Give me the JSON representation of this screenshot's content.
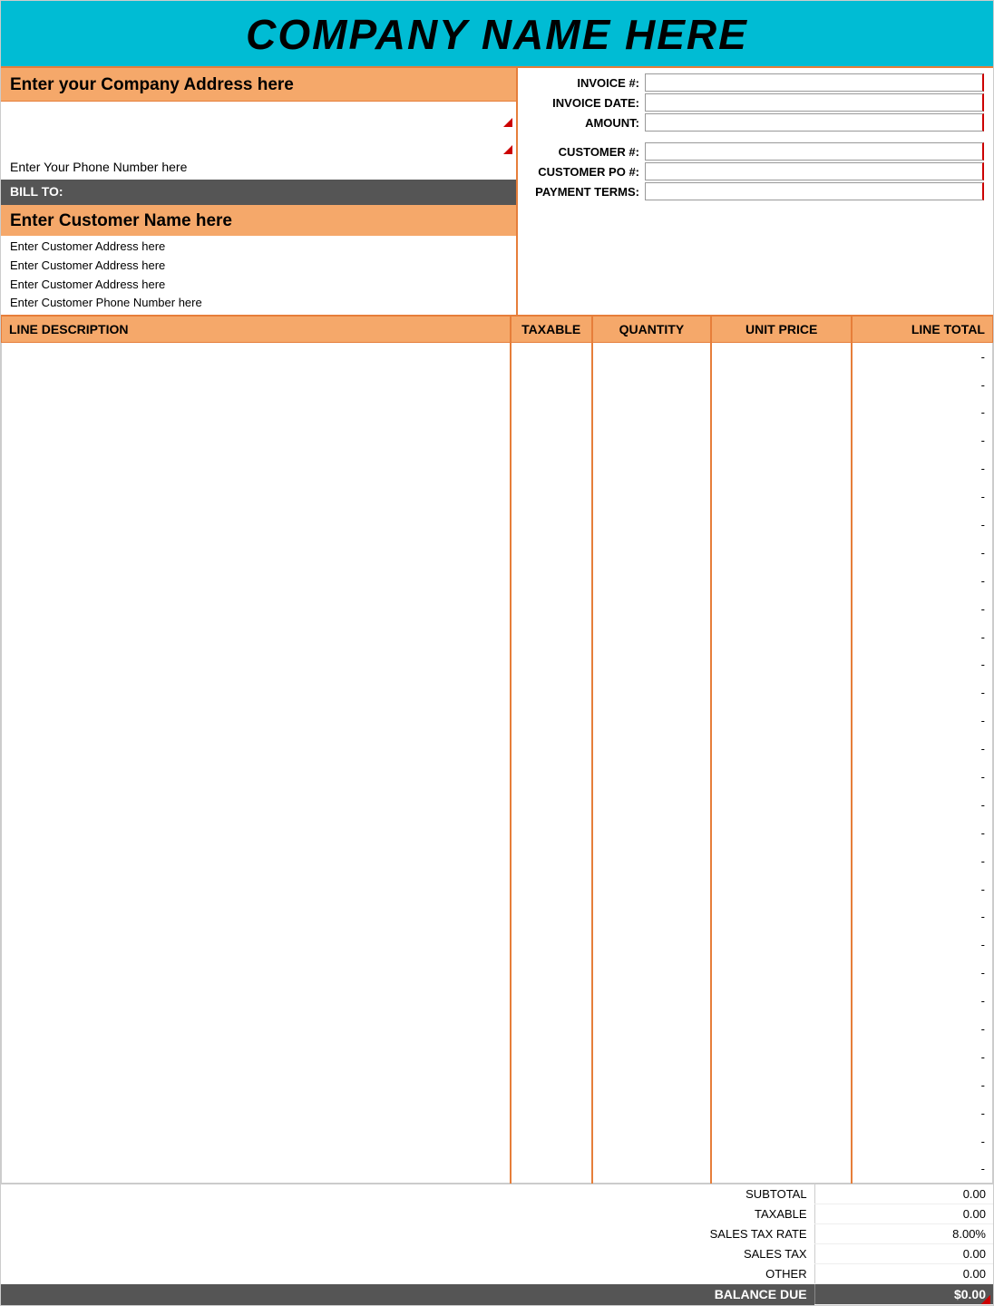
{
  "header": {
    "company_name": "COMPANY NAME HERE"
  },
  "company": {
    "address_label": "Enter your Company Address here",
    "phone": "Enter Your Phone Number here"
  },
  "bill_to": {
    "label": "BILL TO:",
    "customer_name": "Enter Customer Name here",
    "address_lines": [
      "Enter Customer Address here",
      "Enter Customer Address here",
      "Enter Customer Address here",
      "Enter Customer Phone Number here"
    ]
  },
  "invoice_details": {
    "invoice_num_label": "INVOICE #:",
    "invoice_date_label": "INVOICE DATE:",
    "amount_label": "AMOUNT:",
    "customer_num_label": "CUSTOMER #:",
    "customer_po_label": "CUSTOMER PO #:",
    "payment_terms_label": "PAYMENT TERMS:",
    "invoice_num_value": "",
    "invoice_date_value": "",
    "amount_value": "",
    "customer_num_value": "",
    "customer_po_value": "",
    "payment_terms_value": ""
  },
  "table": {
    "headers": {
      "description": "LINE DESCRIPTION",
      "taxable": "TAXABLE",
      "quantity": "QUANTITY",
      "unit_price": "UNIT PRICE",
      "line_total": "LINE TOTAL"
    },
    "rows": 30,
    "dash": "-"
  },
  "totals": {
    "subtotal_label": "SUBTOTAL",
    "subtotal_value": "0.00",
    "taxable_label": "TAXABLE",
    "taxable_value": "0.00",
    "sales_tax_rate_label": "SALES TAX RATE",
    "sales_tax_rate_value": "8.00%",
    "sales_tax_label": "SALES TAX",
    "sales_tax_value": "0.00",
    "other_label": "OTHER",
    "other_value": "0.00",
    "balance_due_label": "BALANCE DUE",
    "balance_due_value": "$0.00"
  }
}
